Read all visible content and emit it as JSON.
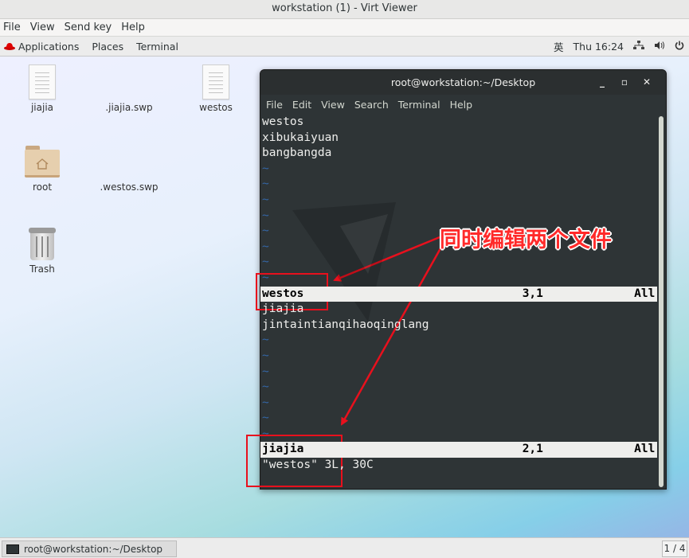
{
  "window": {
    "title": "workstation (1) - Virt Viewer"
  },
  "viewer_menu": [
    "File",
    "View",
    "Send key",
    "Help"
  ],
  "topbar": {
    "applications": "Applications",
    "places": "Places",
    "terminal": "Terminal",
    "input_method": "英",
    "clock": "Thu 16:24",
    "icons": [
      "network-icon",
      "volume-icon",
      "power-icon"
    ]
  },
  "desktop_icons": [
    {
      "label": "jiajia",
      "icon": "text-file-icon"
    },
    {
      "label": ".jiajia.swp",
      "icon": "none"
    },
    {
      "label": "westos",
      "icon": "text-file-icon"
    },
    {
      "label": "root",
      "icon": "home-folder-icon"
    },
    {
      "label": ".westos.swp",
      "icon": "none"
    },
    {
      "label": "Trash",
      "icon": "trash-icon"
    }
  ],
  "terminal": {
    "title": "root@workstation:~/Desktop",
    "menu": [
      "File",
      "Edit",
      "View",
      "Search",
      "Terminal",
      "Help"
    ],
    "top_pane_lines": [
      "westos",
      "xibukaiyuan",
      "bangbangda"
    ],
    "top_status": {
      "name": "westos",
      "pos": "3,1",
      "all": "All"
    },
    "bottom_pane_lines": [
      "jiajia",
      "jintaintianqihaoqinglang"
    ],
    "bottom_status": {
      "name": "jiajia",
      "pos": "2,1",
      "all": "All"
    },
    "message": "\"westos\" 3L, 30C",
    "tilde": "~"
  },
  "annotation": {
    "text": "同时编辑两个文件",
    "color": "#e8101d"
  },
  "taskbar": {
    "task": "root@workstation:~/Desktop",
    "workspace": "1 / 4"
  }
}
